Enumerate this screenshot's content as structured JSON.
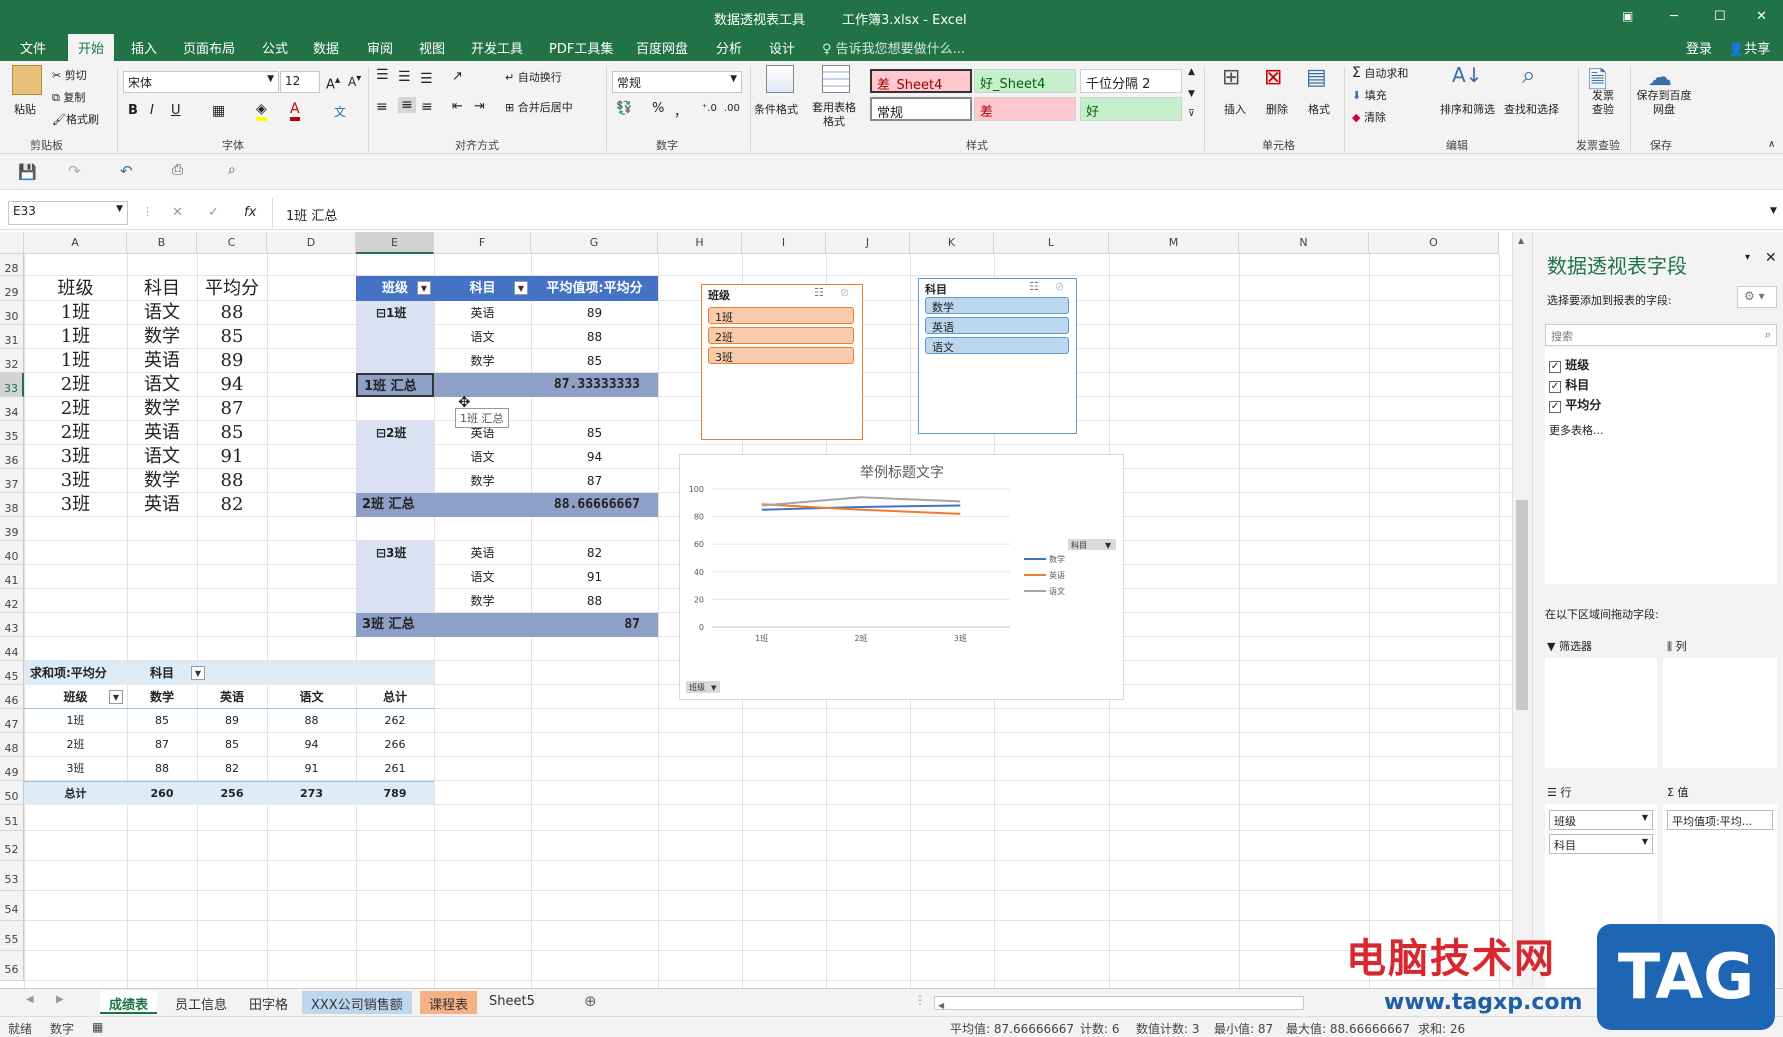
{
  "title": {
    "context_tab": "数据透视表工具",
    "document": "工作簿3.xlsx - Excel"
  },
  "ribbon_tabs": [
    "文件",
    "开始",
    "插入",
    "页面布局",
    "公式",
    "数据",
    "审阅",
    "视图",
    "开发工具",
    "PDF工具集",
    "百度网盘",
    "分析",
    "设计"
  ],
  "tell_me": "告诉我您想要做什么...",
  "account": {
    "login": "登录",
    "share": "共享"
  },
  "clipboard": {
    "paste": "粘贴",
    "cut": "剪切",
    "copy": "复制",
    "format_painter": "格式刷",
    "group": "剪贴板"
  },
  "font": {
    "name": "宋体",
    "size": "12",
    "bold": "B",
    "italic": "I",
    "underline": "U",
    "group": "字体"
  },
  "alignment": {
    "wrap": "自动换行",
    "merge": "合并后居中",
    "group": "对齐方式"
  },
  "number": {
    "format": "常规",
    "percent": "%",
    "comma": "，",
    "group": "数字"
  },
  "styles": {
    "conditional": "条件格式",
    "table_format": "套用表格格式",
    "cells": [
      "差_Sheet4",
      "好_Sheet4",
      "千位分隔 2",
      "常规",
      "差",
      "好"
    ],
    "group": "样式"
  },
  "cells_group": {
    "insert": "插入",
    "delete": "删除",
    "format": "格式",
    "group": "单元格"
  },
  "editing": {
    "autosum": "自动求和",
    "fill": "填充",
    "clear": "清除",
    "sort": "排序和筛选",
    "find": "查找和选择",
    "group": "编辑"
  },
  "invoice": {
    "label": "发票查验",
    "group": "发票查验"
  },
  "save": {
    "label": "保存到百度网盘",
    "group": "保存"
  },
  "formula_bar": {
    "name_box": "E33",
    "fx": "fx",
    "content": "1班 汇总"
  },
  "columns": [
    "A",
    "B",
    "C",
    "D",
    "E",
    "F",
    "G",
    "H",
    "I",
    "J",
    "K",
    "L",
    "M",
    "N",
    "O"
  ],
  "rows": [
    "28",
    "29",
    "30",
    "31",
    "32",
    "33",
    "34",
    "35",
    "36",
    "37",
    "38",
    "39",
    "40",
    "41",
    "42",
    "43",
    "44",
    "45",
    "46",
    "47",
    "48",
    "49",
    "50",
    "51",
    "52",
    "53",
    "54",
    "55",
    "56"
  ],
  "source_table": {
    "headers": [
      "班级",
      "科目",
      "平均分"
    ],
    "rows": [
      [
        "1班",
        "语文",
        "88"
      ],
      [
        "1班",
        "数学",
        "85"
      ],
      [
        "1班",
        "英语",
        "89"
      ],
      [
        "2班",
        "语文",
        "94"
      ],
      [
        "2班",
        "数学",
        "87"
      ],
      [
        "2班",
        "英语",
        "85"
      ],
      [
        "3班",
        "语文",
        "91"
      ],
      [
        "3班",
        "数学",
        "88"
      ],
      [
        "3班",
        "英语",
        "82"
      ]
    ]
  },
  "pivot1": {
    "headers": [
      "班级",
      "科目",
      "平均值项:平均分"
    ],
    "groups": [
      {
        "name": "⊟1班",
        "items": [
          [
            "英语",
            "89"
          ],
          [
            "语文",
            "88"
          ],
          [
            "数学",
            "85"
          ]
        ],
        "total_label": "1班 汇总",
        "total": "87.33333333"
      },
      {
        "name": "⊟2班",
        "items": [
          [
            "英语",
            "85"
          ],
          [
            "语文",
            "94"
          ],
          [
            "数学",
            "87"
          ]
        ],
        "total_label": "2班 汇总",
        "total": "88.66666667"
      },
      {
        "name": "⊟3班",
        "items": [
          [
            "英语",
            "82"
          ],
          [
            "语文",
            "91"
          ],
          [
            "数学",
            "88"
          ]
        ],
        "total_label": "3班 汇总",
        "total": "87"
      }
    ],
    "tooltip": "1班 汇总"
  },
  "pivot2": {
    "title_label": "求和项:平均分",
    "col_field": "科目",
    "headers": [
      "班级",
      "数学",
      "英语",
      "语文",
      "总计"
    ],
    "rows": [
      [
        "1班",
        "85",
        "89",
        "88",
        "262"
      ],
      [
        "2班",
        "87",
        "85",
        "94",
        "266"
      ],
      [
        "3班",
        "88",
        "82",
        "91",
        "261"
      ]
    ],
    "total": [
      "总计",
      "260",
      "256",
      "273",
      "789"
    ]
  },
  "slicer_class": {
    "title": "班级",
    "items": [
      "1班",
      "2班",
      "3班"
    ]
  },
  "slicer_subject": {
    "title": "科目",
    "items": [
      "数学",
      "英语",
      "语文"
    ]
  },
  "chart_data": {
    "type": "line",
    "title": "举例标题文字",
    "categories": [
      "1班",
      "2班",
      "3班"
    ],
    "series": [
      {
        "name": "数学",
        "values": [
          85,
          87,
          88
        ],
        "color": "#4472c4"
      },
      {
        "name": "英语",
        "values": [
          89,
          85,
          82
        ],
        "color": "#ed7d31"
      },
      {
        "name": "语文",
        "values": [
          88,
          94,
          91
        ],
        "color": "#a5a5a5"
      }
    ],
    "ylim": [
      0,
      100
    ],
    "yticks": [
      "100",
      "80",
      "60",
      "40",
      "20",
      "0"
    ],
    "legend_title": "科目",
    "axis_button": "班级",
    "legend_position": "right",
    "grid": true
  },
  "field_pane": {
    "title": "数据透视表字段",
    "subtitle": "选择要添加到报表的字段:",
    "search_placeholder": "搜索",
    "fields": [
      "班级",
      "科目",
      "平均分"
    ],
    "more": "更多表格...",
    "drag_hint": "在以下区域间拖动字段:",
    "filters": "筛选器",
    "columns": "列",
    "rows_label": "行",
    "values_label": "值",
    "row_fields": [
      "班级",
      "科目"
    ],
    "value_field": "平均值项:平均..."
  },
  "sheet_tabs": [
    {
      "name": "成绩表",
      "active": true,
      "color": ""
    },
    {
      "name": "员工信息",
      "active": false,
      "color": ""
    },
    {
      "name": "田字格",
      "active": false,
      "color": ""
    },
    {
      "name": "XXX公司销售额",
      "active": false,
      "color": "#bdd7ee"
    },
    {
      "name": "课程表",
      "active": false,
      "color": "#f4b183"
    },
    {
      "name": "Sheet5",
      "active": false,
      "color": ""
    }
  ],
  "status": {
    "mode": "就绪",
    "numlock": "数字",
    "average": "平均值: 87.66666667",
    "count": "计数: 6",
    "numcount": "数值计数: 3",
    "min": "最小值: 87",
    "max": "最大值: 88.66666667",
    "sum": "求和: 26"
  },
  "watermark": {
    "text": "电脑技术网",
    "tag": "TAG",
    "url": "www.tagxp.com"
  }
}
